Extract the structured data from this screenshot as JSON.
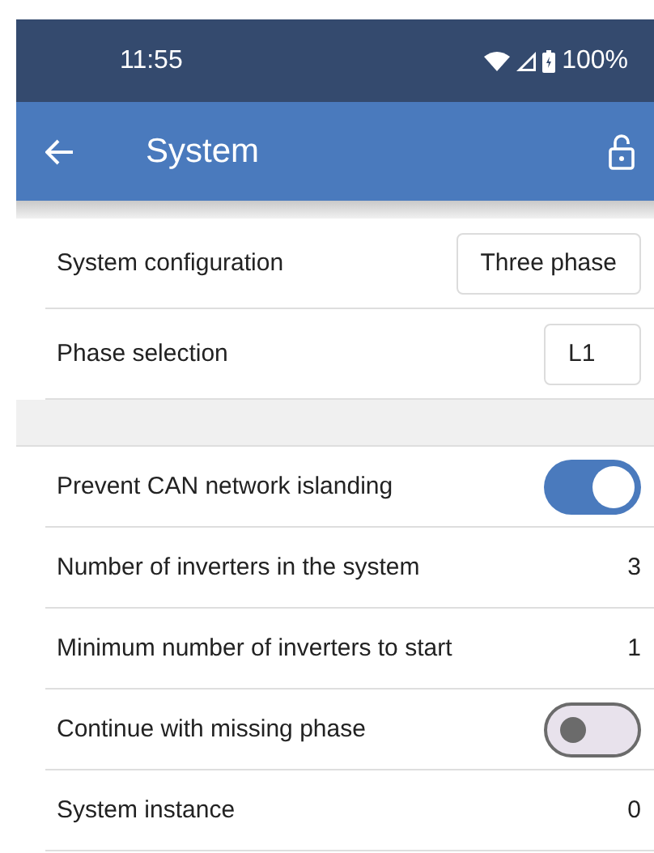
{
  "status_bar": {
    "time": "11:55",
    "battery": "100%"
  },
  "app_bar": {
    "title": "System"
  },
  "sections": [
    {
      "rows": [
        {
          "kind": "select",
          "label": "System configuration",
          "value": "Three phase"
        },
        {
          "kind": "select",
          "label": "Phase selection",
          "value": "L1"
        }
      ]
    },
    {
      "rows": [
        {
          "kind": "toggle",
          "label": "Prevent CAN network islanding",
          "on": true
        },
        {
          "kind": "value",
          "label": "Number of inverters in the system",
          "value": "3"
        },
        {
          "kind": "value",
          "label": "Minimum number of inverters to start",
          "value": "1"
        },
        {
          "kind": "toggle",
          "label": "Continue with missing phase",
          "on": false
        },
        {
          "kind": "value",
          "label": "System instance",
          "value": "0"
        }
      ]
    }
  ]
}
